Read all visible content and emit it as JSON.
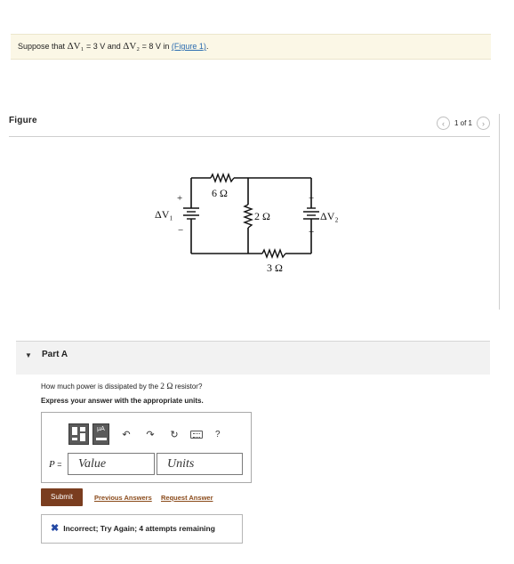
{
  "problem": {
    "prefix": "Suppose that",
    "v1_symbol": "ΔV₁",
    "v1_value": "= 3 V and",
    "v2_symbol": "ΔV₂",
    "v2_value": "= 8 V in",
    "link_text": "(Figure 1)",
    "suffix": "."
  },
  "figure": {
    "title": "Figure",
    "pager_text": "1 of 1",
    "prev_icon": "chevron-left-icon",
    "next_icon": "chevron-right-icon",
    "circuit": {
      "r_top": "6 Ω",
      "r_middle": "2 Ω",
      "r_bottom": "3 Ω",
      "source_left": "ΔV₁",
      "source_right": "ΔV₂",
      "plus": "+",
      "minus": "−"
    }
  },
  "part": {
    "caret_icon": "caret-down-icon",
    "label": "Part A",
    "question_prefix": "How much power is dissipated by the",
    "question_math": "2 Ω",
    "question_suffix": "resistor?",
    "instruction": "Express your answer with the appropriate units."
  },
  "toolbar": {
    "template2_label": "μA",
    "undo_icon": "undo-icon",
    "redo_icon": "redo-icon",
    "reset_icon": "reset-icon",
    "keyboard_icon": "keyboard-icon",
    "help_label": "?"
  },
  "answer": {
    "variable": "P",
    "equals": "=",
    "value_placeholder": "Value",
    "units_placeholder": "Units"
  },
  "actions": {
    "submit": "Submit",
    "previous_answers": "Previous Answers",
    "request_answer": "Request Answer"
  },
  "feedback": {
    "icon": "x-icon",
    "text": "Incorrect; Try Again; 4 attempts remaining"
  },
  "colors": {
    "problem_bg": "#fbf7e6",
    "submit_bg": "#7a3d1f",
    "link": "#8a4a1a",
    "x_icon": "#2348a4"
  }
}
